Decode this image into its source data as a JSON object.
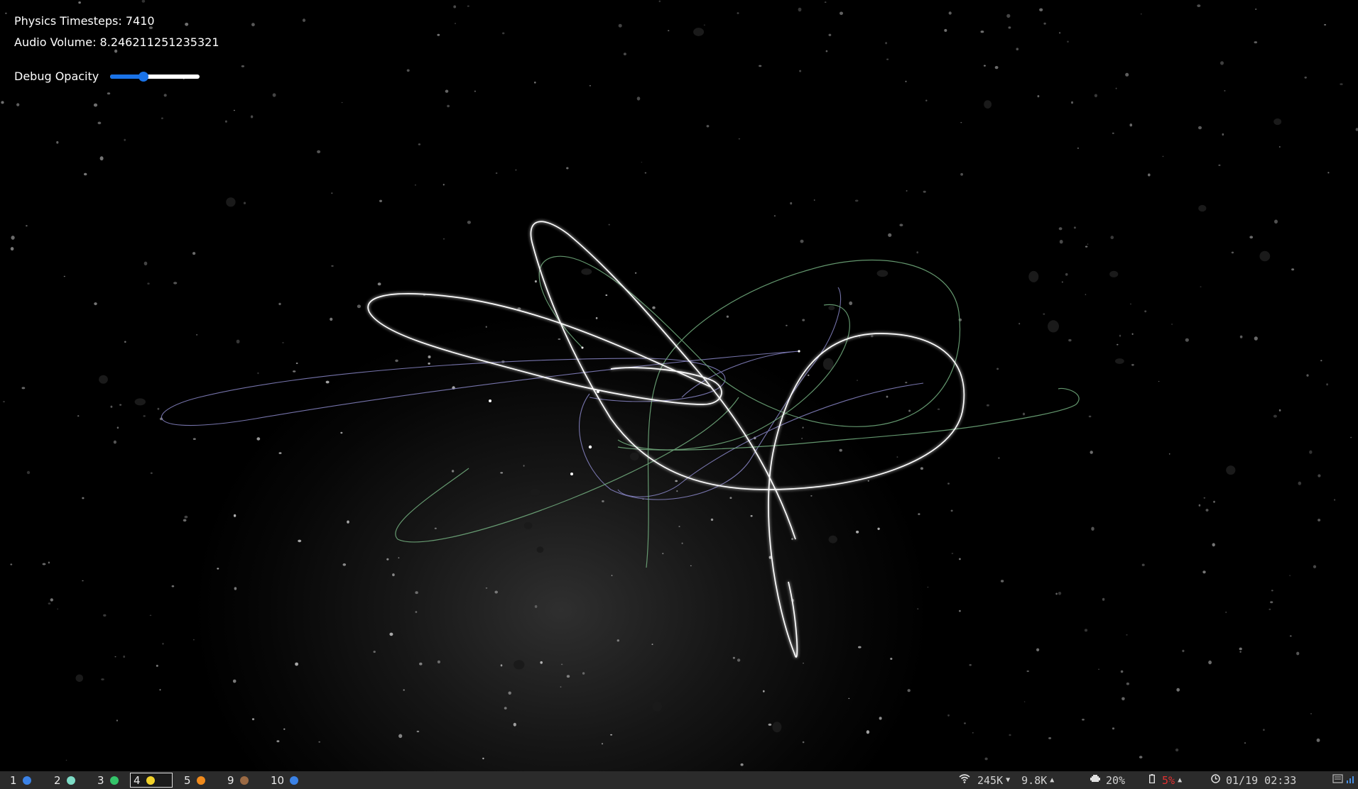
{
  "hud": {
    "timesteps": "Physics Timesteps: 7410",
    "volume": "Audio Volume: 8.246211251235321",
    "debug_label": "Debug Opacity",
    "debug_opacity": 0.37
  },
  "taskbar": {
    "workspaces": [
      {
        "num": "1",
        "color": "#3b82e6",
        "active": false
      },
      {
        "num": "2",
        "color": "#7ddcc6",
        "active": false
      },
      {
        "num": "3",
        "color": "#34c46a",
        "active": false
      },
      {
        "num": "4",
        "color": "#f2d22a",
        "active": true
      },
      {
        "num": "5",
        "color": "#f08a1c",
        "active": false
      },
      {
        "num": "9",
        "color": "#9b6a44",
        "active": false
      },
      {
        "num": "10",
        "color": "#3b82e6",
        "active": false
      }
    ],
    "net_down": "245K",
    "net_up": "9.8K",
    "cpu": "20%",
    "battery": "5%",
    "datetime": "01/19 02:33",
    "icons": {
      "wifi": "wifi-icon",
      "cpu": "cpu-icon",
      "battery": "battery-icon",
      "clock": "clock-icon",
      "tray": "tray-icon",
      "signal": "signal-icon"
    }
  }
}
